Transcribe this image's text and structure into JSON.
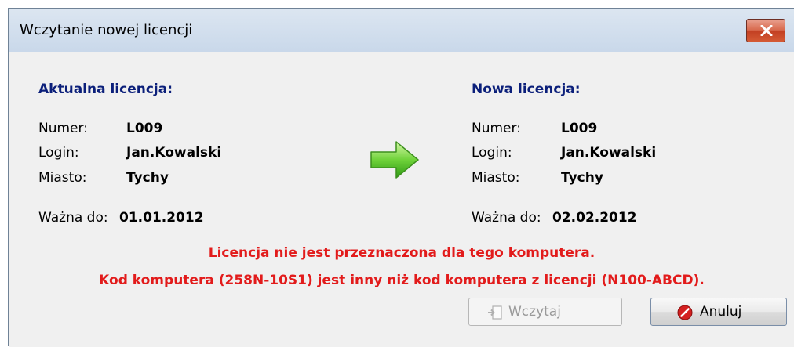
{
  "window": {
    "title": "Wczytanie nowej licencji",
    "close_icon": "close-icon"
  },
  "current_license": {
    "heading": "Aktualna licencja:",
    "number_label": "Numer:",
    "number_value": "L009",
    "login_label": "Login:",
    "login_value": "Jan.Kowalski",
    "city_label": "Miasto:",
    "city_value": "Tychy",
    "valid_label": "Ważna do:",
    "valid_value": "01.01.2012"
  },
  "new_license": {
    "heading": "Nowa licencja:",
    "number_label": "Numer:",
    "number_value": "L009",
    "login_label": "Login:",
    "login_value": "Jan.Kowalski",
    "city_label": "Miasto:",
    "city_value": "Tychy",
    "valid_label": "Ważna do:",
    "valid_value": "02.02.2012"
  },
  "arrow_icon": "green-arrow-right-icon",
  "messages": {
    "line1": "Licencja nie jest przeznaczona dla tego komputera.",
    "line2": "Kod komputera (258N-10S1) jest inny niż kod komputera z licencji (N100-ABCD)."
  },
  "buttons": {
    "load_label": "Wczytaj",
    "load_enabled": false,
    "load_icon": "import-icon",
    "cancel_label": "Anuluj",
    "cancel_icon": "cancel-icon"
  },
  "colors": {
    "heading": "#0b1f7a",
    "error": "#e21b1b",
    "background": "#f0f0f0",
    "titlebar": "#dce6f1"
  }
}
